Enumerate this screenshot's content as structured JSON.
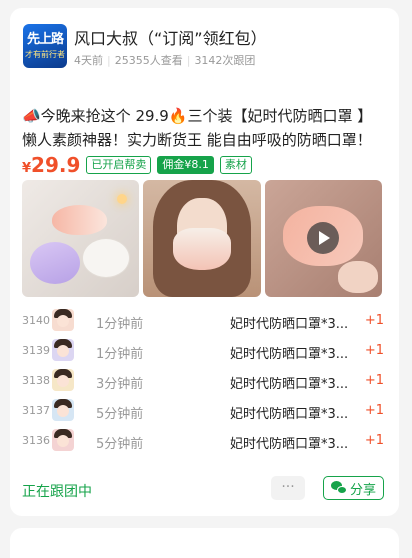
{
  "account": {
    "avatar_line1": "先上路",
    "avatar_line2": "才有前行者",
    "name": "风口大叔（“订阅”领红包）",
    "time_ago": "4天前",
    "views": "25355人查看",
    "follows": "3142次跟团"
  },
  "post": {
    "line1": "📣今晚来抢这个 29.9🔥三个装【妃时代防晒口罩 】",
    "line2": "懒人素颜神器！实力断货王 能自由呼吸的防晒口罩！",
    "price_symbol": "¥",
    "price": "29.9",
    "tag_help_sell": "已开启帮卖",
    "tag_commission": "佣金¥8.1",
    "tag_material": "素材"
  },
  "images": [
    {
      "icon": "masks-product-photo"
    },
    {
      "icon": "woman-wearing-mask-photo"
    },
    {
      "icon": "mask-video-thumbnail"
    }
  ],
  "orders": [
    {
      "num": "3140",
      "time": "1分钟前",
      "product": "妃时代防晒口罩*3...",
      "qty": "+1"
    },
    {
      "num": "3139",
      "time": "1分钟前",
      "product": "妃时代防晒口罩*3...",
      "qty": "+1"
    },
    {
      "num": "3138",
      "time": "3分钟前",
      "product": "妃时代防晒口罩*3...",
      "qty": "+1"
    },
    {
      "num": "3137",
      "time": "5分钟前",
      "product": "妃时代防晒口罩*3...",
      "qty": "+1"
    },
    {
      "num": "3136",
      "time": "5分钟前",
      "product": "妃时代防晒口罩*3...",
      "qty": "+1"
    }
  ],
  "footer": {
    "status": "正在跟团中",
    "more": "···",
    "share": "分享"
  },
  "colors": {
    "accent_green": "#16a34a",
    "price_red": "#f0502a",
    "background": "#f4f4f4"
  }
}
